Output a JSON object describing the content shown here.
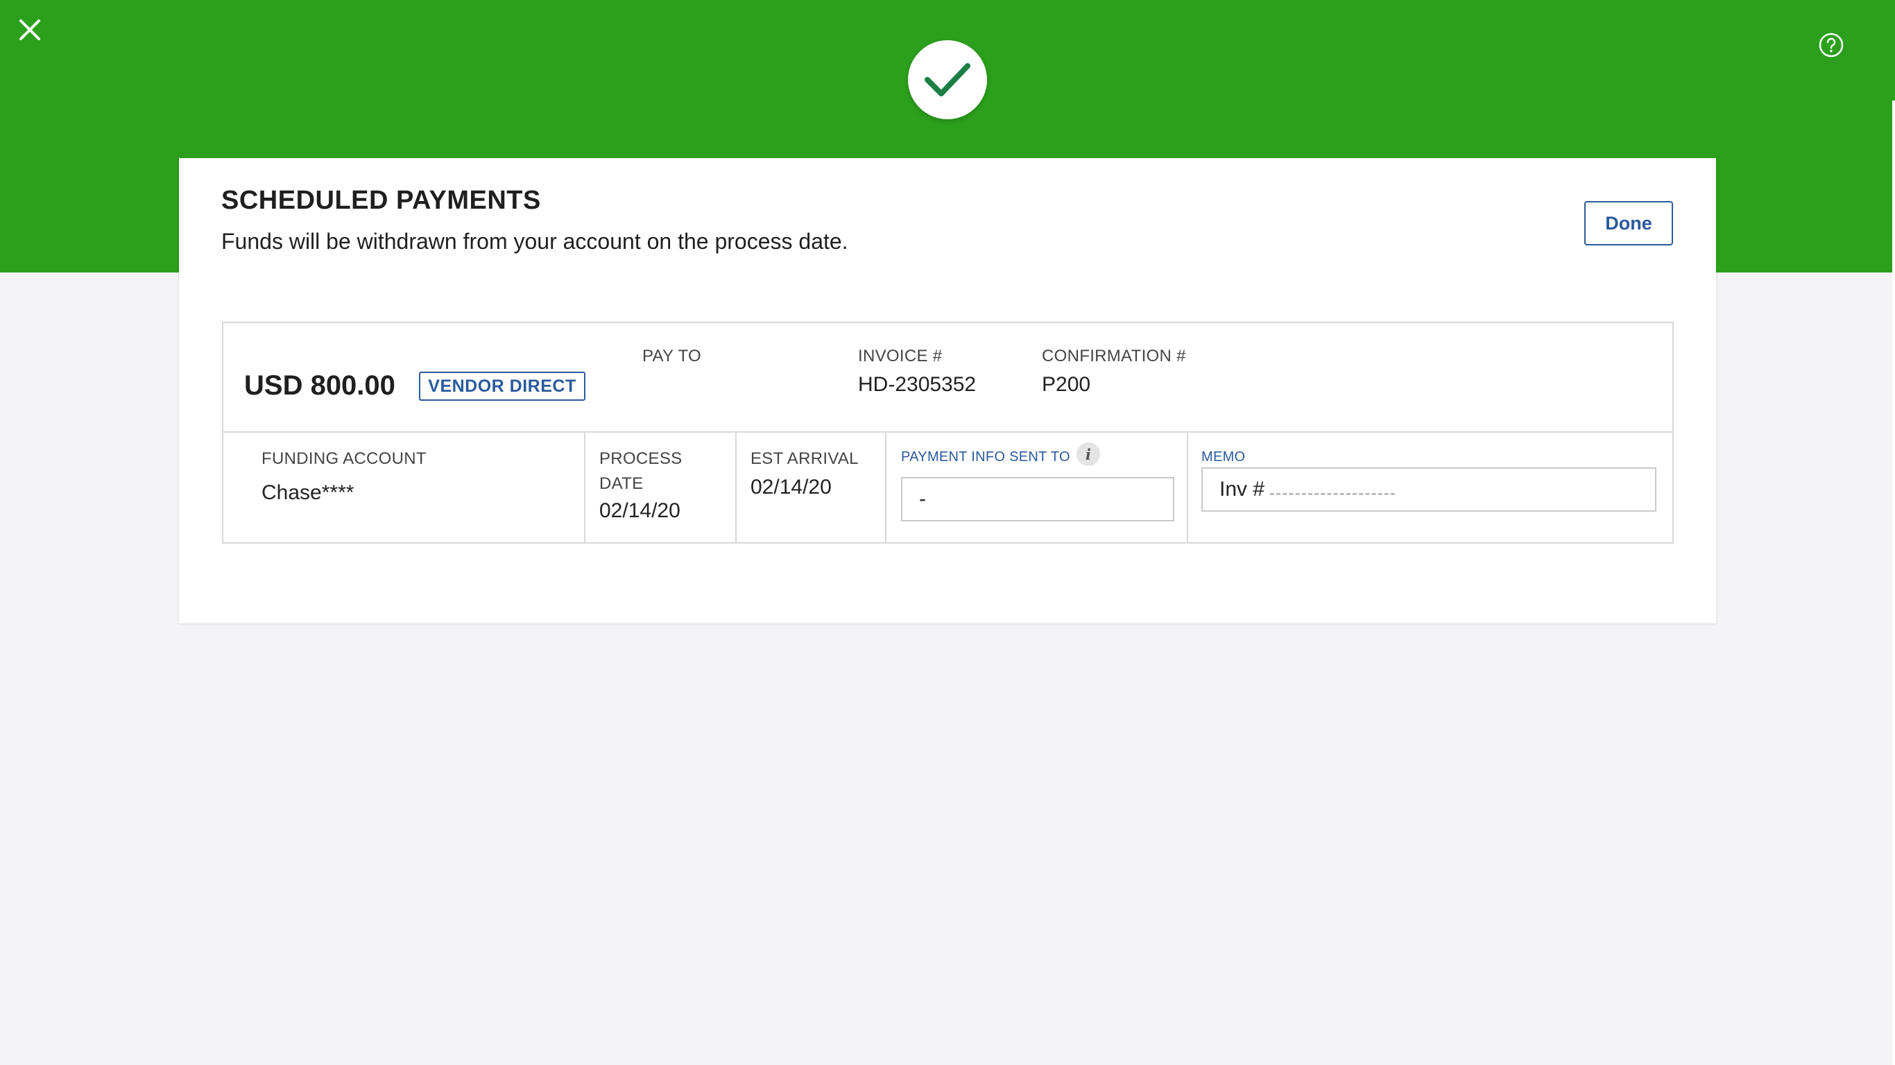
{
  "header": {
    "close_icon": "close-icon",
    "help_icon": "help-icon",
    "success_icon": "checkmark-icon",
    "brand_color": "#2ca01c"
  },
  "card": {
    "title": "SCHEDULED PAYMENTS",
    "subtitle": "Funds will be withdrawn from your account on the process date.",
    "done_label": "Done"
  },
  "payment": {
    "amount": "USD 800.00",
    "badge": "VENDOR DIRECT",
    "pay_to_label": "PAY TO",
    "pay_to_value": "",
    "invoice_label": "INVOICE #",
    "invoice_value": "HD-2305352",
    "confirmation_label": "CONFIRMATION #",
    "confirmation_value": "P200",
    "funding_label": "FUNDING ACCOUNT",
    "funding_value": "Chase****",
    "process_label_line1": "PROCESS",
    "process_label_line2": "DATE",
    "process_value": "02/14/20",
    "arrival_label": "EST ARRIVAL",
    "arrival_value": "02/14/20",
    "info_sent_label": "PAYMENT INFO SENT TO",
    "info_sent_value": "-",
    "memo_label": "MEMO",
    "memo_value": "Inv #"
  }
}
